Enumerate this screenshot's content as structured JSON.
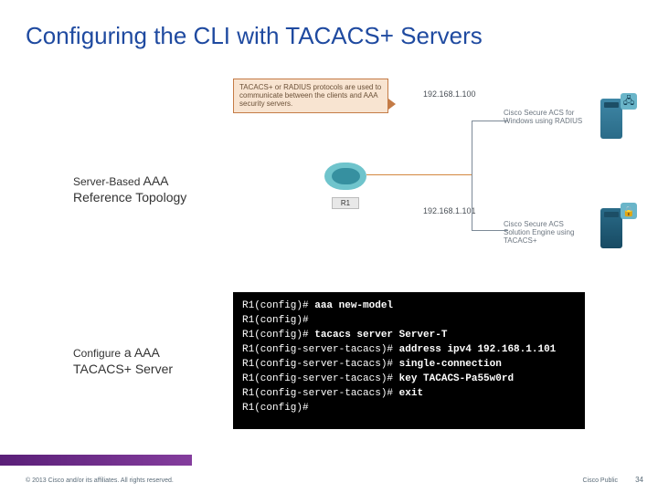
{
  "title": "Configuring the CLI with TACACS+ Servers",
  "label1_line1_small": "Server-Based",
  "label1_line1_big": " AAA",
  "label1_line2": "Reference Topology",
  "label2_line1_small": "Configure",
  "label2_line1_big": " a AAA",
  "label2_line2": "TACACS+ Server",
  "callout_text": "TACACS+ or RADIUS protocols are used to communicate between the clients and AAA security servers.",
  "ip1": "192.168.1.100",
  "ip2": "192.168.1.101",
  "router_label": "R1",
  "server1_caption": "Cisco Secure ACS for Windows using RADIUS",
  "server2_caption": "Cisco Secure ACS Solution Engine using TACACS+",
  "server1_glyph": "🖧",
  "server2_glyph": "🔒",
  "terminal": {
    "p0": "R1(config)# ",
    "c0": "aaa new-model",
    "p1": "R1(config)#",
    "c1": "",
    "p2": "R1(config)# ",
    "c2": "tacacs server Server-T",
    "p3": "R1(config-server-tacacs)# ",
    "c3": "address ipv4 192.168.1.101",
    "p4": "R1(config-server-tacacs)# ",
    "c4": "single-connection",
    "p5": "R1(config-server-tacacs)# ",
    "c5": "key TACACS-Pa55w0rd",
    "p6": "R1(config-server-tacacs)# ",
    "c6": "exit",
    "p7": "R1(config)#",
    "c7": ""
  },
  "copyright": "© 2013 Cisco and/or its affiliates. All rights reserved.",
  "cisco_public": "Cisco Public",
  "page_number": "34"
}
